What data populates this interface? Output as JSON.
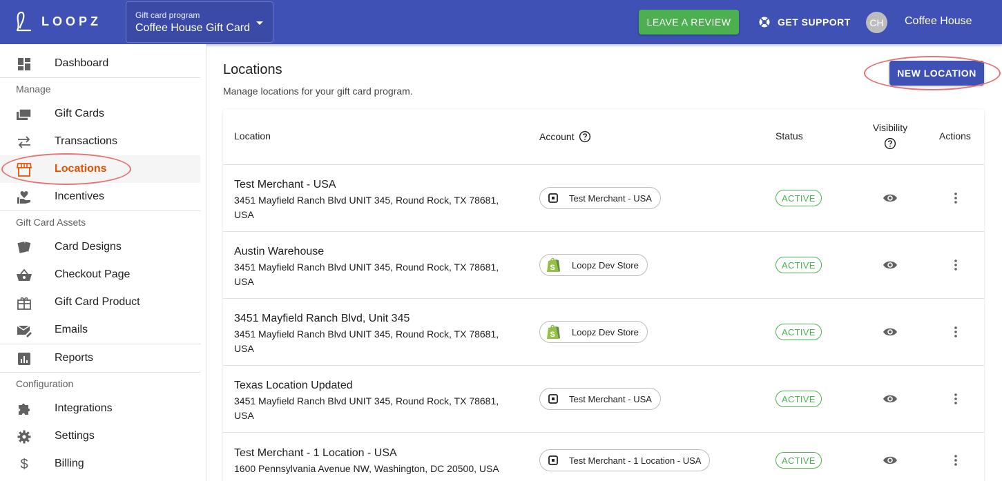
{
  "topbar": {
    "logo_text": "LOOPZ",
    "program_caption": "Gift card program",
    "program_value": "Coffee House Gift Card",
    "review_label": "LEAVE A REVIEW",
    "support_label": "GET SUPPORT",
    "avatar_initials": "CH",
    "user_name": "Coffee House"
  },
  "sidebar": {
    "dashboard": "Dashboard",
    "section_manage": "Manage",
    "gift_cards": "Gift Cards",
    "transactions": "Transactions",
    "locations": "Locations",
    "incentives": "Incentives",
    "section_assets": "Gift Card Assets",
    "card_designs": "Card Designs",
    "checkout_page": "Checkout Page",
    "gift_card_product": "Gift Card Product",
    "emails": "Emails",
    "reports": "Reports",
    "section_config": "Configuration",
    "integrations": "Integrations",
    "settings": "Settings",
    "billing": "Billing"
  },
  "main": {
    "title": "Locations",
    "subtitle": "Manage locations for your gift card program.",
    "new_button": "NEW LOCATION"
  },
  "table": {
    "headers": {
      "location": "Location",
      "account": "Account",
      "status": "Status",
      "visibility": "Visibility",
      "actions": "Actions"
    },
    "rows": [
      {
        "name": "Test Merchant - USA",
        "address": "3451 Mayfield Ranch Blvd UNIT 345, Round Rock, TX 78681, USA",
        "account": "Test Merchant - USA",
        "account_type": "square",
        "status": "ACTIVE"
      },
      {
        "name": "Austin Warehouse",
        "address": "3451 Mayfield Ranch Blvd UNIT 345, Round Rock, TX 78681, USA",
        "account": "Loopz Dev Store",
        "account_type": "shopify",
        "status": "ACTIVE"
      },
      {
        "name": "3451 Mayfield Ranch Blvd, Unit 345",
        "address": "3451 Mayfield Ranch Blvd UNIT 345, Round Rock, TX 78681, USA",
        "account": "Loopz Dev Store",
        "account_type": "shopify",
        "status": "ACTIVE"
      },
      {
        "name": "Texas Location Updated",
        "address": "3451 Mayfield Ranch Blvd UNIT 345, Round Rock, TX 78681, USA",
        "account": "Test Merchant - USA",
        "account_type": "square",
        "status": "ACTIVE"
      },
      {
        "name": "Test Merchant - 1 Location - USA",
        "address": "1600 Pennsylvania Avenue NW, Washington, DC 20500, USA",
        "account": "Test Merchant - 1 Location - USA",
        "account_type": "square",
        "status": "ACTIVE"
      }
    ]
  },
  "colors": {
    "primary": "#3f51b5",
    "review_green": "#4caf50",
    "active_orange": "#e65100",
    "status_green": "#4caf50",
    "annotation_red": "#e57373"
  }
}
